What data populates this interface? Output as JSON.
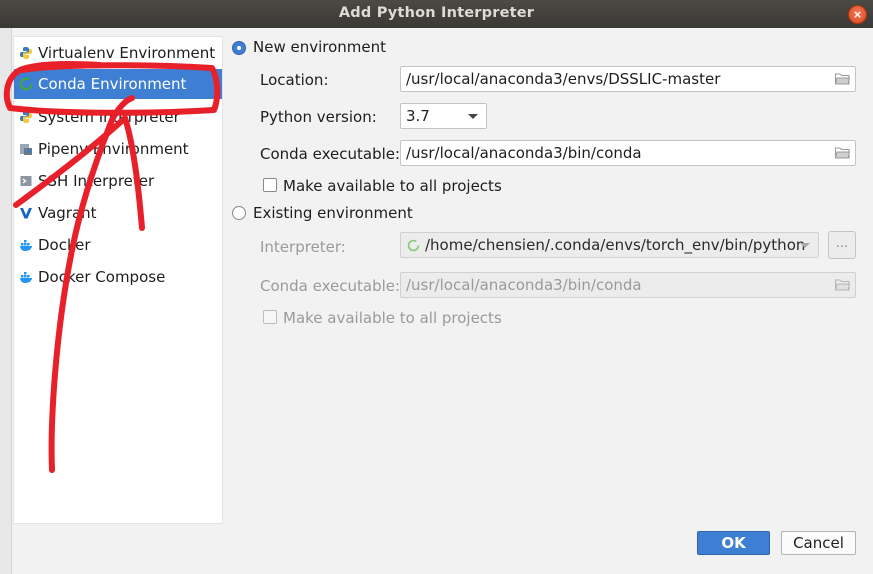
{
  "window": {
    "title": "Add Python Interpreter",
    "close_glyph": "×"
  },
  "sidebar": {
    "items": [
      {
        "label": "Virtualenv Environment",
        "icon": "python-icon"
      },
      {
        "label": "Conda Environment",
        "icon": "conda-icon"
      },
      {
        "label": "System Interpreter",
        "icon": "python-icon"
      },
      {
        "label": "Pipenv Environment",
        "icon": "pipenv-icon"
      },
      {
        "label": "SSH Interpreter",
        "icon": "terminal-icon"
      },
      {
        "label": "Vagrant",
        "icon": "vagrant-icon"
      },
      {
        "label": "Docker",
        "icon": "docker-icon"
      },
      {
        "label": "Docker Compose",
        "icon": "docker-icon"
      }
    ],
    "selected_index": 1
  },
  "new_env": {
    "radio_label": "New environment",
    "location_label": "Location:",
    "location_value": "/usr/local/anaconda3/envs/DSSLIC-master",
    "python_version_label": "Python version:",
    "python_version_value": "3.7",
    "conda_exe_label": "Conda executable:",
    "conda_exe_value": "/usr/local/anaconda3/bin/conda",
    "make_available_label": "Make available to all projects"
  },
  "existing_env": {
    "radio_label": "Existing environment",
    "interpreter_label": "Interpreter:",
    "interpreter_value": "/home/chensien/.conda/envs/torch_env/bin/python",
    "browse_label": "...",
    "conda_exe_label": "Conda executable:",
    "conda_exe_value": "/usr/local/anaconda3/bin/conda",
    "make_available_label": "Make available to all projects"
  },
  "buttons": {
    "ok": "OK",
    "cancel": "Cancel"
  },
  "colors": {
    "accent": "#3f7fd3",
    "annotation": "#e8202a",
    "conda_green": "#44a833"
  }
}
